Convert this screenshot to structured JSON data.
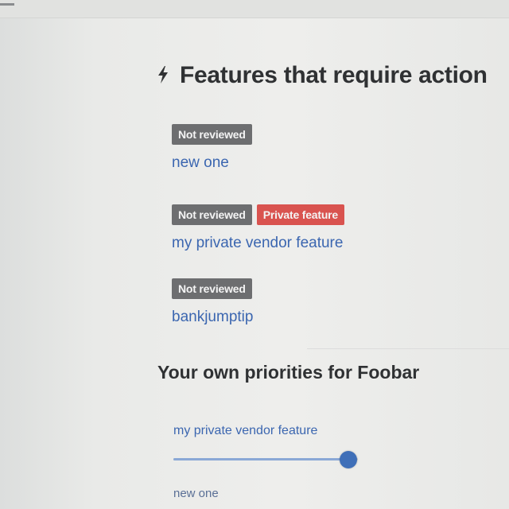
{
  "section": {
    "icon": "bolt-icon",
    "title": "Features that require action"
  },
  "features": [
    {
      "badges": [
        "Not reviewed"
      ],
      "name": "new one"
    },
    {
      "badges": [
        "Not reviewed",
        "Private feature"
      ],
      "name": "my private vendor feature"
    },
    {
      "badges": [
        "Not reviewed"
      ],
      "name": "bankjumptip"
    }
  ],
  "priorities": {
    "title": "Your own priorities for Foobar",
    "items": [
      {
        "name": "my private vendor feature",
        "level": 0.95
      },
      {
        "name": "new one"
      }
    ]
  },
  "colors": {
    "badge_not_reviewed": "#6d6e70",
    "badge_private": "#d9534f",
    "link": "#3b66b0",
    "slider_thumb": "#3f6fb8"
  }
}
